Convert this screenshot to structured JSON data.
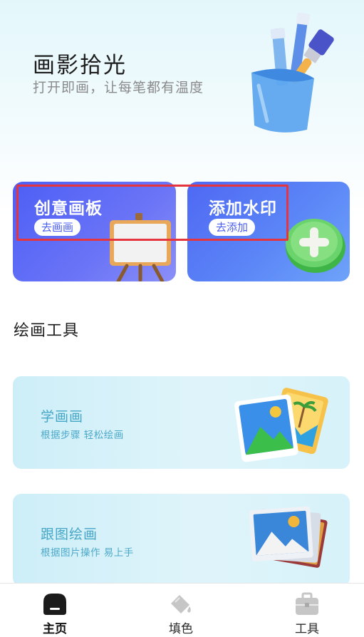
{
  "hero": {
    "title": "画影拾光",
    "subtitle": "打开即画，让每笔都有温度",
    "art_icon": "paint-bucket-brushes-illustration"
  },
  "cards": [
    {
      "title": "创意画板",
      "button": "去画画",
      "icon": "easel-illustration"
    },
    {
      "title": "添加水印",
      "button": "去添加",
      "icon": "green-plus-illustration"
    }
  ],
  "section": {
    "title": "绘画工具"
  },
  "tools": [
    {
      "title": "学画画",
      "subtitle": "根据步骤 轻松绘画",
      "icon": "photo-cards-illustration"
    },
    {
      "title": "跟图绘画",
      "subtitle": "根据图片操作 易上手",
      "icon": "picture-stack-illustration"
    }
  ],
  "tabbar": {
    "items": [
      {
        "label": "主页",
        "icon": "home-icon",
        "active": true
      },
      {
        "label": "填色",
        "icon": "paint-bucket-icon",
        "active": false
      },
      {
        "label": "工具",
        "icon": "toolbox-icon",
        "active": false
      }
    ]
  },
  "colors": {
    "accent": "#4d5ff5",
    "tool_text": "#45a6c7",
    "highlight": "#e5353f"
  }
}
